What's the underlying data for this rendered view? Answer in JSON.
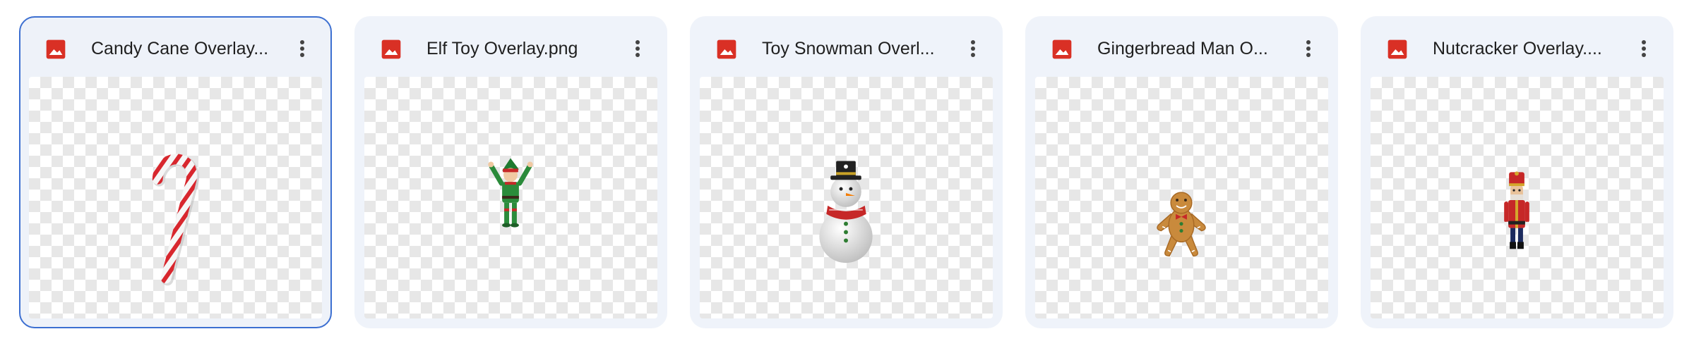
{
  "files": [
    {
      "name": "Candy Cane Overlay...",
      "icon": "image-file-icon",
      "thumbnail": "candy-cane-image",
      "selected": true
    },
    {
      "name": "Elf Toy Overlay.png",
      "icon": "image-file-icon",
      "thumbnail": "elf-toy-image",
      "selected": false
    },
    {
      "name": "Toy Snowman Overl...",
      "icon": "image-file-icon",
      "thumbnail": "snowman-image",
      "selected": false
    },
    {
      "name": "Gingerbread Man O...",
      "icon": "image-file-icon",
      "thumbnail": "gingerbread-man-image",
      "selected": false
    },
    {
      "name": "Nutcracker Overlay....",
      "icon": "image-file-icon",
      "thumbnail": "nutcracker-image",
      "selected": false
    }
  ],
  "colors": {
    "card_background": "#eff3fa",
    "selected_border": "#3c6fd1",
    "image_icon": "#d93025"
  }
}
